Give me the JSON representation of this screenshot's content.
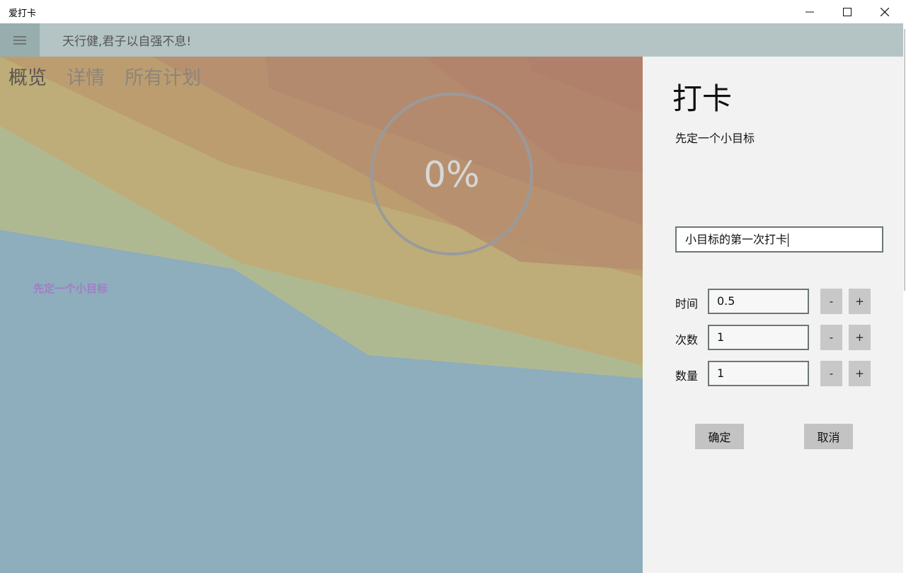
{
  "window": {
    "title": "爱打卡",
    "minimize_glyph": "—",
    "maximize_glyph": "☐",
    "close_glyph": "✕"
  },
  "appbar": {
    "menu_icon": "hamburger-menu-icon",
    "motto": "天行健,君子以自强不息!"
  },
  "tabs": [
    {
      "label": "概览",
      "active": true
    },
    {
      "label": "详情",
      "active": false
    },
    {
      "label": "所有计划",
      "active": false
    }
  ],
  "overview": {
    "progress_text": "0%",
    "progress_value": 0,
    "goal_label": "先定一个小目标"
  },
  "checkin_panel": {
    "title": "打卡",
    "goal_name": "先定一个小目标",
    "note_value": "小目标的第一次打卡",
    "fields": [
      {
        "label": "时间",
        "value": "0.5",
        "minus": "-",
        "plus": "+"
      },
      {
        "label": "次数",
        "value": "1",
        "minus": "-",
        "plus": "+"
      },
      {
        "label": "数量",
        "value": "1",
        "minus": "-",
        "plus": "+"
      }
    ],
    "confirm_label": "确定",
    "cancel_label": "取消"
  },
  "colors": {
    "appbar": "#b4c4c4",
    "hamburger_bg": "#98adad",
    "panel_bg": "#f2f2f2",
    "band_blue": "#8eadbd",
    "band_green": "#afb991",
    "band_yellow": "#bead78",
    "band_orange": "#bb9d70",
    "band_peach": "#b6906f",
    "band_red": "#b1806b",
    "goal_label": "#a07ec4"
  }
}
